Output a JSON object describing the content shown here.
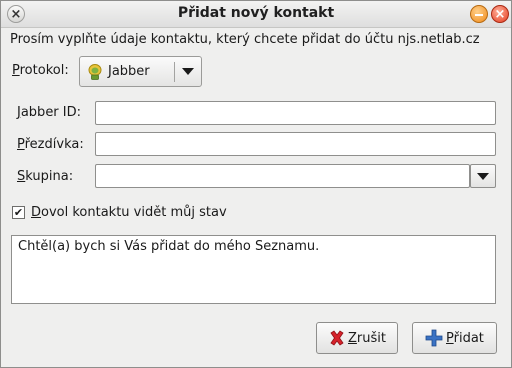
{
  "window": {
    "title": "Přidat nový kontakt"
  },
  "intro_text": "Prosím vyplňte údaje kontaktu, který chcete přidat do účtu njs.netlab.cz",
  "protocol": {
    "label_first": "P",
    "label_rest": "rotokol:",
    "selected": "Jabber",
    "icon": "jabber-lightbulb-icon"
  },
  "fields": {
    "jabber_id": {
      "label_first": "J",
      "label_rest": "abber ID:",
      "value": ""
    },
    "nickname": {
      "label_first": "P",
      "label_rest": "řezdívka:",
      "value": ""
    },
    "group": {
      "label_first": "S",
      "label_rest": "kupina:",
      "value": ""
    }
  },
  "allow_status": {
    "checked": true,
    "label_first": "D",
    "label_rest": "ovol kontaktu vidět můj stav"
  },
  "message": "Chtěl(a) bych si Vás přidat do mého Seznamu.",
  "buttons": {
    "cancel_first": "Z",
    "cancel_rest": "rušit",
    "add_first": "P",
    "add_rest": "řidat"
  },
  "colors": {
    "cancel_icon": "#d6222b",
    "add_icon": "#3a72c4",
    "minimize": "#f08a1a",
    "close": "#e43b1e"
  }
}
